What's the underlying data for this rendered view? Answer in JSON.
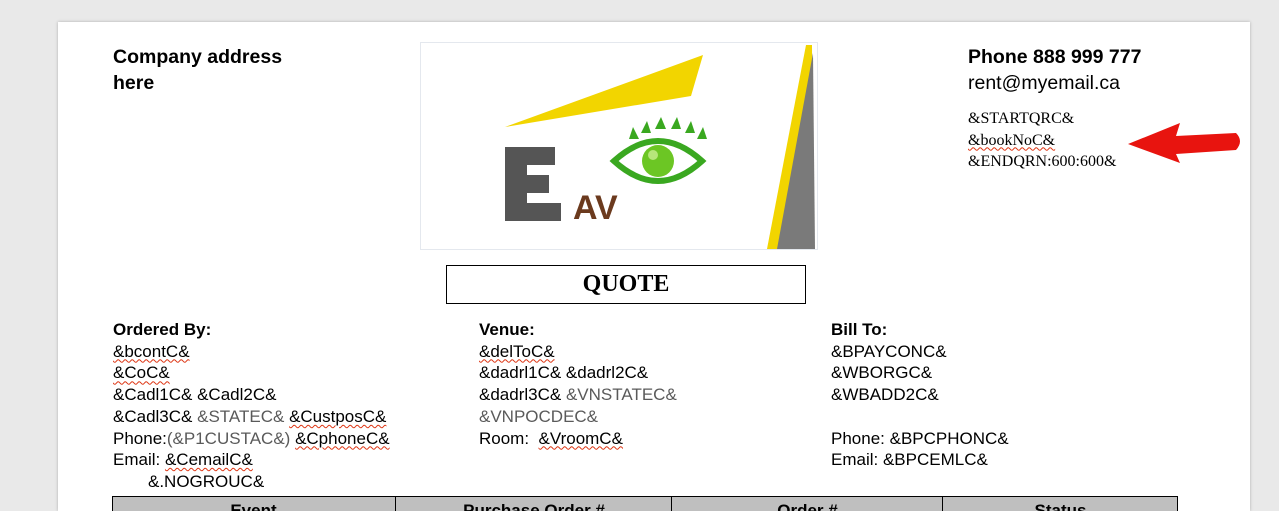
{
  "header": {
    "company_address": "Company address here",
    "phone": "Phone 888 999 777",
    "email": "rent@myemail.ca",
    "qrc_lines": [
      "&STARTQRC&",
      "&bookNoC&",
      "&ENDQRN:600:600&"
    ]
  },
  "logo": {
    "letter": "E",
    "text": "AV",
    "colors": {
      "yellow": "#f2d500",
      "grey": "#555555",
      "brown": "#6b3a1e",
      "green": "#3aa820"
    }
  },
  "arrow": {
    "color": "#e8140f"
  },
  "title": "QUOTE",
  "ordered_by": {
    "heading": "Ordered By:",
    "line1": "&bcontC&",
    "line2": "&CoC&",
    "line3": "&Cadl1C& &Cadl2C&",
    "line4a": "&Cadl3C&",
    "line4b": "&STATEC&",
    "line4c": "&CustposC&",
    "phone_label": "Phone:",
    "phone_code": "(&P1CUSTAC&)",
    "phone_value": "&CphoneC&",
    "email_label": "Email:",
    "email_value": "&CemailC&",
    "line_last": "&.NOGROUC&"
  },
  "venue": {
    "heading": "Venue:",
    "line1": "&delToC&",
    "line2": "&dadrl1C&  &dadrl2C&",
    "line3a": "&dadrl3C&",
    "line3b": "&VNSTATEC&",
    "line4": "&VNPOCDEC&",
    "room_label": "Room:",
    "room_value": "&VroomC&"
  },
  "bill_to": {
    "heading": "Bill To:",
    "line1": "&BPAYCONC&",
    "line2": "&WBORGC&",
    "line3": "&WBADD2C&",
    "phone": "Phone: &BPCPHONC&",
    "email": "Email: &BPCEMLC&"
  },
  "table": {
    "headers": [
      "Event",
      "Purchase Order #",
      "Order #",
      "Status"
    ]
  }
}
